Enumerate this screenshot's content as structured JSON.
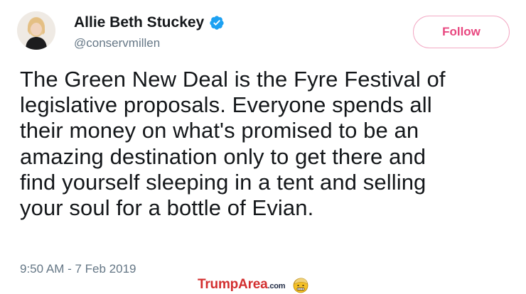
{
  "tweet": {
    "author": {
      "name": "Allie Beth Stuckey",
      "handle": "@conservmillen",
      "verified": true
    },
    "follow_label": "Follow",
    "text": "The Green New Deal is the Fyre Festival of\nlegislative proposals. Everyone spends all\ntheir money on what's promised to be an\namazing destination only to get there and\nfind yourself sleeping in a tent and selling\nyour soul for a bottle of Evian.",
    "timestamp": "9:50 AM - 7 Feb 2019"
  },
  "watermark": {
    "brand": "TrumpArea",
    "tld": ".com",
    "logo_icon": "trump-face-emoji-icon"
  },
  "colors": {
    "text_primary": "#14171a",
    "text_secondary": "#657786",
    "verified_blue": "#1da1f2",
    "follow_accent": "#e8477f",
    "follow_border": "#f3a9c4",
    "watermark_red": "#d32f2f",
    "watermark_navy": "#1f2a44"
  }
}
